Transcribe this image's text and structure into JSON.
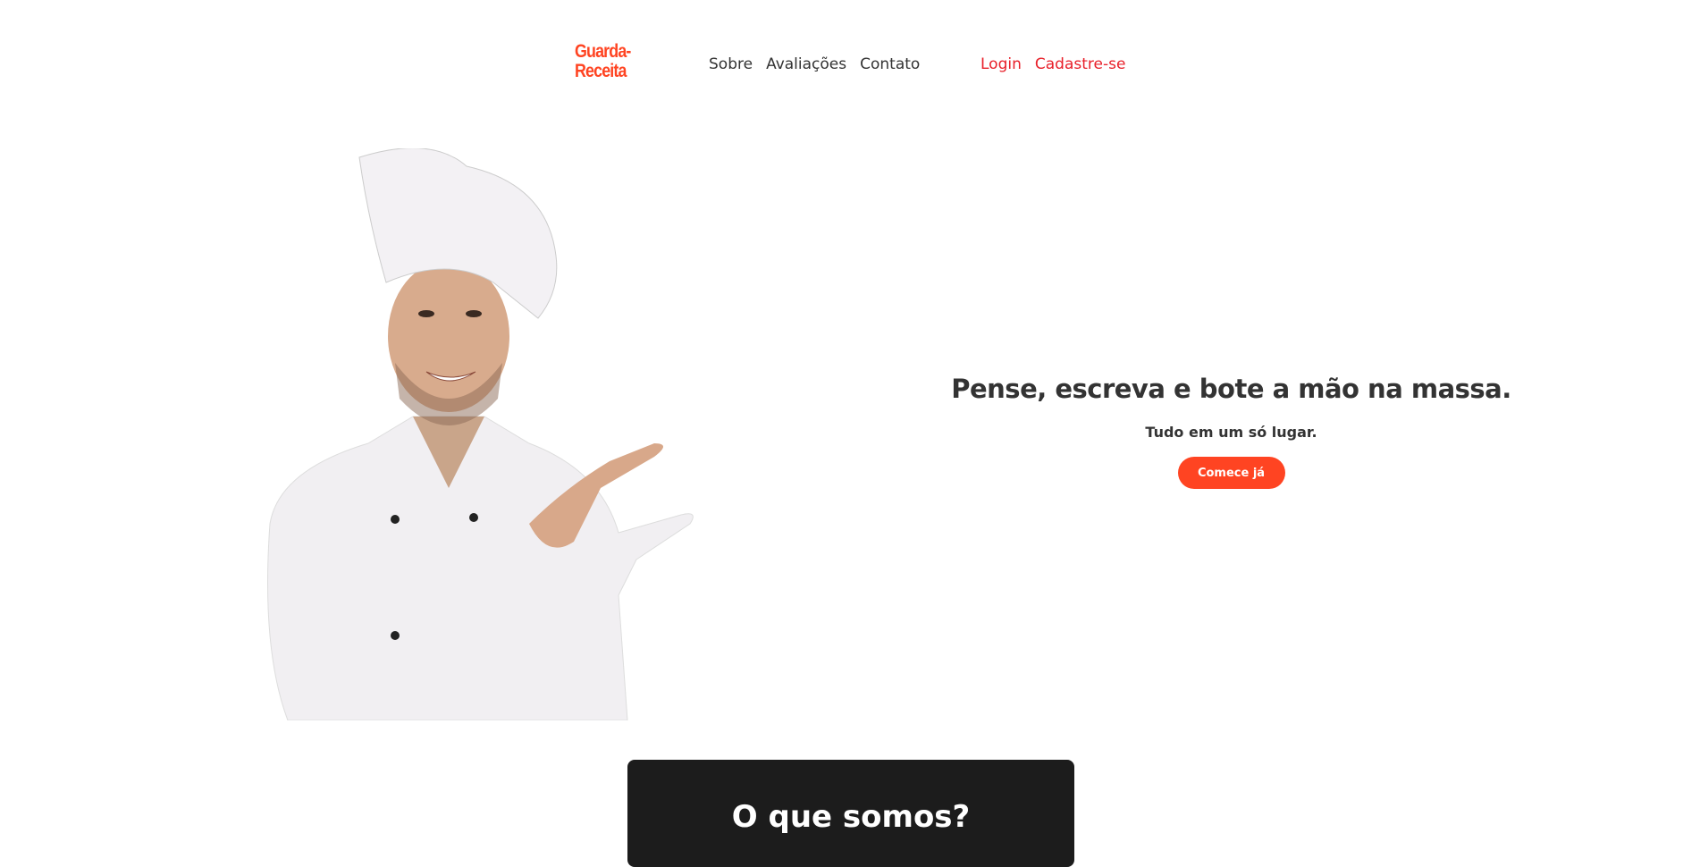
{
  "header": {
    "logo": "Guarda-\nReceita",
    "logo_line1": "Guarda-",
    "logo_line2": "Receita",
    "nav": [
      "Sobre",
      "Avaliações",
      "Contato"
    ],
    "auth": [
      "Login",
      "Cadastre-se"
    ]
  },
  "hero": {
    "title": "Pense, escreva e bote a mão na massa.",
    "subtitle": "Tudo em um só lugar.",
    "cta": "Comece já"
  },
  "section": {
    "title": "O que somos?"
  },
  "colors": {
    "accent": "#ff4422",
    "auth": "#e8202a",
    "text": "#333333",
    "dark": "#1c1c1c"
  }
}
